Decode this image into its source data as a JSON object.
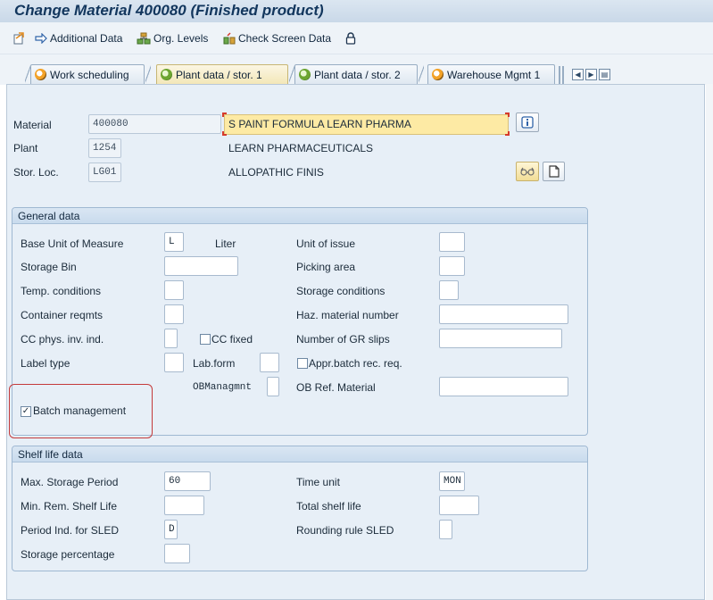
{
  "window": {
    "title": "Change Material 400080 (Finished product)"
  },
  "toolbar": {
    "additional_data": "Additional Data",
    "org_levels": "Org. Levels",
    "check_screen_data": "Check Screen Data"
  },
  "tabs": [
    {
      "label": "Work scheduling",
      "state": "open"
    },
    {
      "label": "Plant data / stor. 1",
      "state": "active"
    },
    {
      "label": "Plant data / stor. 2",
      "state": "done"
    },
    {
      "label": "Warehouse Mgmt 1",
      "state": "open"
    }
  ],
  "header": {
    "material_label": "Material",
    "material_value": "400080",
    "material_desc": "S PAINT FORMULA LEARN PHARMA",
    "plant_label": "Plant",
    "plant_value": "1254",
    "plant_desc": "LEARN PHARMACEUTICALS",
    "storloc_label": "Stor. Loc.",
    "storloc_value": "LG01",
    "storloc_desc": "ALLOPATHIC FINIS"
  },
  "general": {
    "title": "General data",
    "base_uom_label": "Base Unit of Measure",
    "base_uom_value": "L",
    "base_uom_text": "Liter",
    "storage_bin_label": "Storage Bin",
    "temp_conditions_label": "Temp. conditions",
    "container_reqmts_label": "Container reqmts",
    "cc_phys_label": "CC phys. inv. ind.",
    "cc_fixed_label": "CC fixed",
    "label_type_label": "Label type",
    "lab_form_label": "Lab.form",
    "ob_managmnt_label": "OBManagmnt",
    "unit_issue_label": "Unit of issue",
    "picking_area_label": "Picking area",
    "storage_conditions_label": "Storage conditions",
    "haz_material_label": "Haz. material number",
    "gr_slips_label": "Number of GR slips",
    "appr_batch_label": "Appr.batch rec. req.",
    "ob_ref_label": "OB Ref. Material",
    "batch_mgmt_label": "Batch management",
    "batch_mgmt_checked": "✓"
  },
  "shelf": {
    "title": "Shelf life data",
    "max_storage_label": "Max. Storage Period",
    "max_storage_value": "60",
    "min_rem_label": "Min. Rem. Shelf Life",
    "period_ind_label": "Period Ind. for SLED",
    "period_ind_value": "D",
    "storage_pct_label": "Storage percentage",
    "time_unit_label": "Time unit",
    "time_unit_value": "MON",
    "total_shelf_label": "Total shelf life",
    "rounding_label": "Rounding rule SLED"
  },
  "colors": {
    "title": "#12365d",
    "description_highlight": "#fdeaa4",
    "batch_highlight": "#c43a3a"
  }
}
